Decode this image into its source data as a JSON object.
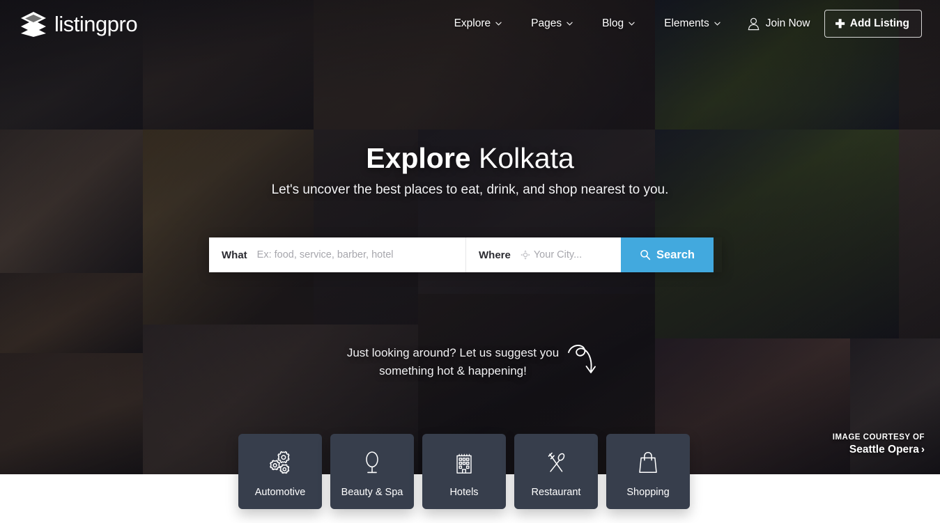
{
  "brand": {
    "name": "listingpro",
    "logo_icon": "stacked-layers-icon"
  },
  "nav": {
    "items": [
      {
        "label": "Explore",
        "has_dropdown": true
      },
      {
        "label": "Pages",
        "has_dropdown": true
      },
      {
        "label": "Blog",
        "has_dropdown": true
      },
      {
        "label": "Elements",
        "has_dropdown": true
      }
    ],
    "join": {
      "label": "Join Now",
      "icon": "user-icon"
    },
    "add_listing": {
      "label": "Add Listing",
      "icon": "plus-icon"
    }
  },
  "hero": {
    "title_bold": "Explore",
    "title_light": "Kolkata",
    "subtitle": "Let's uncover the best places to eat, drink, and shop nearest to you.",
    "suggest_line1": "Just looking around? Let us suggest you",
    "suggest_line2": "something hot & happening!",
    "arrow_icon": "curved-arrow-icon"
  },
  "search": {
    "what_label": "What",
    "what_placeholder": "Ex: food, service, barber, hotel",
    "what_value": "",
    "where_label": "Where",
    "where_placeholder": "Your City...",
    "where_value": "",
    "where_icon": "crosshair-location-icon",
    "button_label": "Search",
    "button_icon": "magnifier-icon",
    "button_color": "#42a9de"
  },
  "categories": [
    {
      "label": "Automotive",
      "icon": "gears-icon"
    },
    {
      "label": "Beauty & Spa",
      "icon": "vanity-mirror-icon"
    },
    {
      "label": "Hotels",
      "icon": "hotel-building-icon"
    },
    {
      "label": "Restaurant",
      "icon": "fork-spoon-crossed-icon"
    },
    {
      "label": "Shopping",
      "icon": "shopping-bag-icon"
    }
  ],
  "card_color": "#373e4c",
  "courtesy": {
    "prefix": "IMAGE COURTESY OF",
    "name": "Seattle Opera",
    "chevron": "›"
  }
}
